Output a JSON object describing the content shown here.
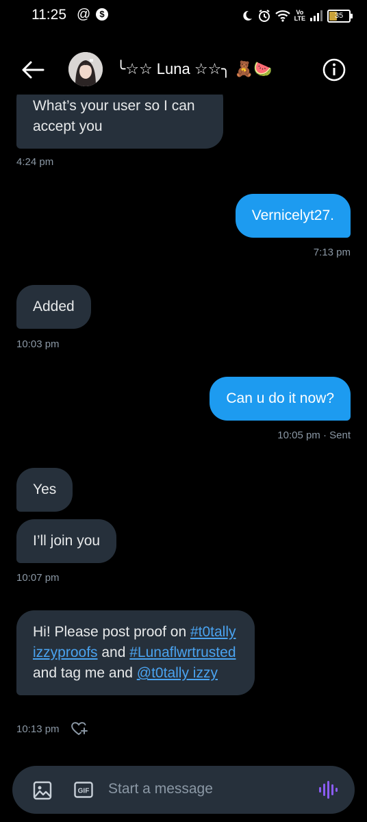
{
  "status_bar": {
    "time": "11:25",
    "at_icon": "@",
    "dollar_icon": "$",
    "volte": "Vo\nLTE",
    "battery": "35"
  },
  "header": {
    "name": "╰☆☆ Luna ☆☆╮ 🧸🍉"
  },
  "messages": [
    {
      "direction": "in",
      "text": "What’s your user so I can accept you",
      "time": "4:24 pm"
    },
    {
      "direction": "out",
      "text": "Vernicelyt27.",
      "time": "7:13 pm"
    },
    {
      "direction": "in",
      "text": "Added",
      "time": "10:03 pm"
    },
    {
      "direction": "out",
      "text": "Can u do it now?",
      "time": "10:05 pm · Sent"
    },
    {
      "direction": "in",
      "text": "Yes"
    },
    {
      "direction": "in",
      "text": "I’ll join you",
      "time": "10:07 pm"
    },
    {
      "direction": "in",
      "parts": {
        "p1": "Hi! Please post proof on ",
        "link1": "#t0tally izzyproofs",
        "p2": " and ",
        "link2": "#Lunaflwrtrusted",
        "p3": " and tag me and ",
        "link3": "@t0tally izzy"
      },
      "time": "10:13 pm"
    }
  ],
  "composer": {
    "placeholder": "Start a message",
    "gif_label": "GIF"
  },
  "colors": {
    "background": "#000000",
    "incoming_bubble": "#26303b",
    "outgoing_bubble": "#1d9bf0",
    "link": "#4aa3f0",
    "timestamp": "#8b98a5",
    "voice_icon": "#8b5cf6"
  }
}
